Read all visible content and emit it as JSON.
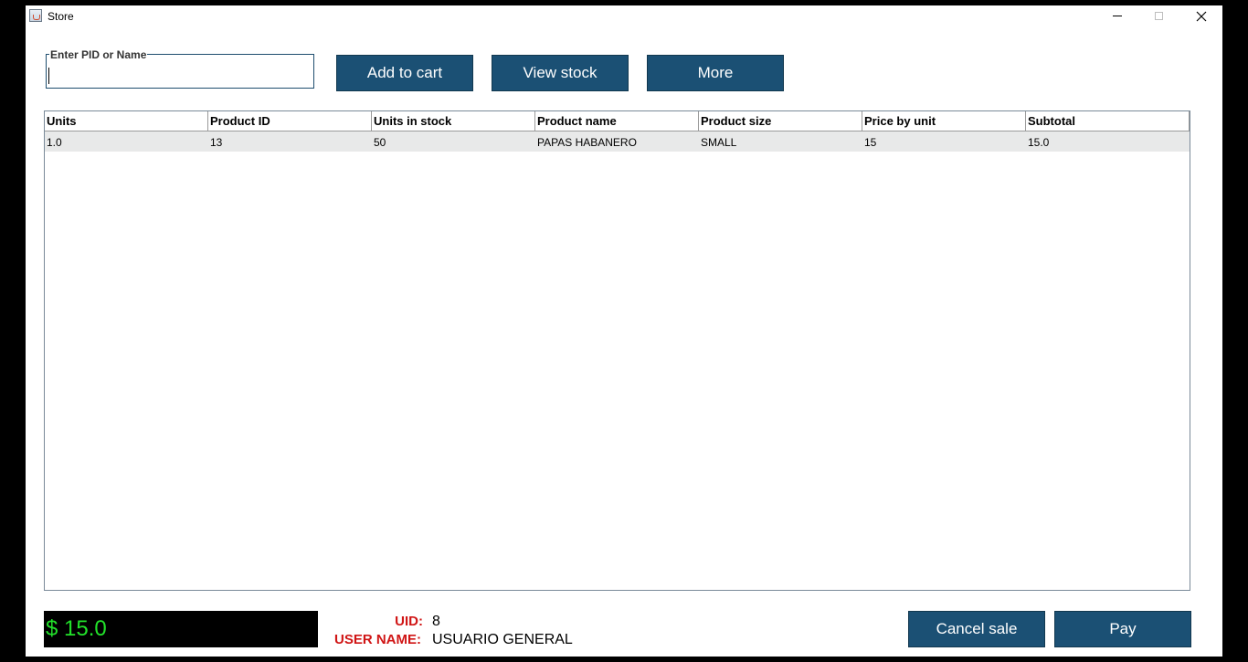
{
  "window": {
    "title": "Store"
  },
  "search": {
    "legend": "Enter PID or Name",
    "value": "",
    "placeholder": ""
  },
  "buttons": {
    "add_to_cart": "Add to cart",
    "view_stock": "View stock",
    "more": "More",
    "cancel_sale": "Cancel sale",
    "pay": "Pay"
  },
  "table": {
    "columns": [
      "Units",
      "Product ID",
      "Units in stock",
      "Product name",
      "Product size",
      "Price by unit",
      "Subtotal"
    ],
    "rows": [
      [
        "1.0",
        "13",
        "50",
        "PAPAS HABANERO",
        "SMALL",
        "15",
        "15.0"
      ]
    ]
  },
  "footer": {
    "total": "$ 15.0",
    "uid_label": "UID:",
    "uid_value": "8",
    "username_label": "USER NAME:",
    "username_value": "USUARIO GENERAL"
  },
  "colors": {
    "button_bg": "#1b5074",
    "total_text": "#22e12a",
    "label_red": "#d01515",
    "row_bg": "#e8e9e9"
  }
}
